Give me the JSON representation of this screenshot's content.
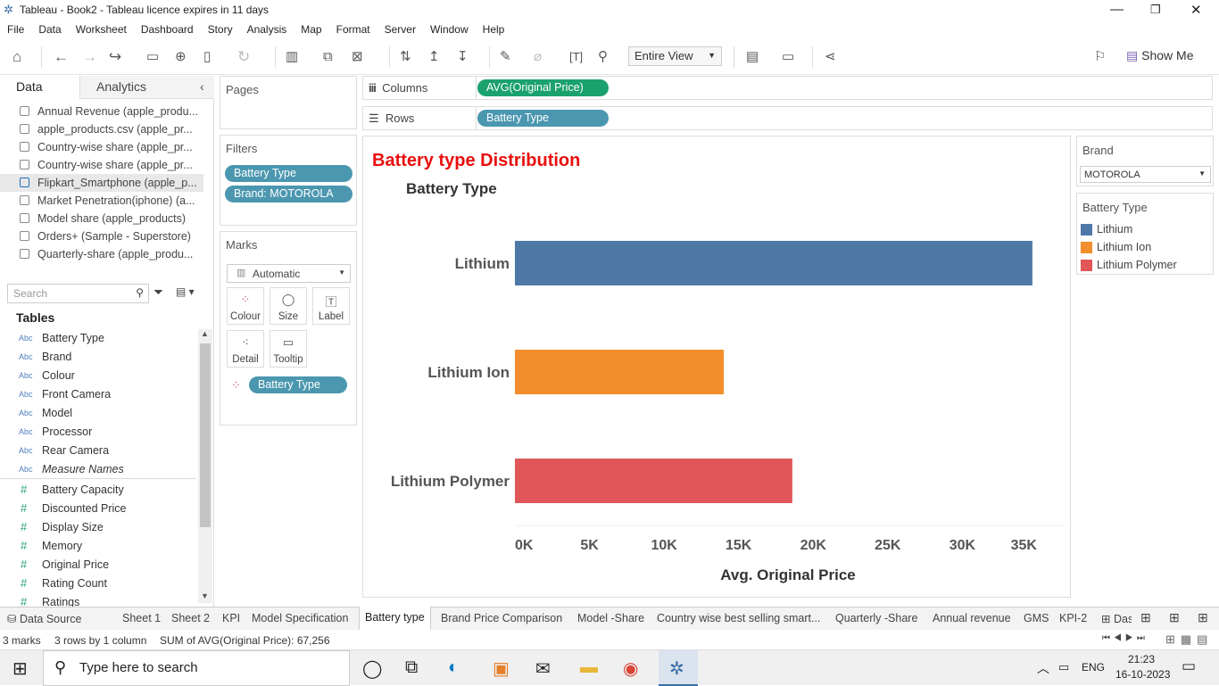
{
  "window": {
    "title": "Tableau - Book2 - Tableau licence expires in 11 days"
  },
  "menu": [
    "File",
    "Data",
    "Worksheet",
    "Dashboard",
    "Story",
    "Analysis",
    "Map",
    "Format",
    "Server",
    "Window",
    "Help"
  ],
  "toolbar": {
    "view_select": "Entire View",
    "show_me": "Show Me"
  },
  "left_pane": {
    "tabs": {
      "data": "Data",
      "analytics": "Analytics"
    },
    "data_sources": [
      "Annual Revenue (apple_produ...",
      "apple_products.csv (apple_pr...",
      "Country-wise share (apple_pr...",
      "Country-wise share (apple_pr...",
      "Flipkart_Smartphone (apple_p...",
      "Market Penetration(iphone) (a...",
      "Model share (apple_products)",
      "Orders+ (Sample - Superstore)",
      "Quarterly-share (apple_produ..."
    ],
    "search_placeholder": "Search",
    "tables_heading": "Tables",
    "dimensions": [
      "Battery Type",
      "Brand",
      "Colour",
      "Front Camera",
      "Model",
      "Processor",
      "Rear Camera",
      "Measure Names"
    ],
    "measures": [
      "Battery Capacity",
      "Discounted Price",
      "Display Size",
      "Memory",
      "Original Price",
      "Rating Count",
      "Ratings"
    ],
    "abc": "Abc",
    "hash": "#"
  },
  "pages": {
    "title": "Pages"
  },
  "filters": {
    "title": "Filters",
    "pills": [
      "Battery Type",
      "Brand: MOTOROLA"
    ]
  },
  "marks": {
    "title": "Marks",
    "type": "Automatic",
    "buttons": [
      "Colour",
      "Size",
      "Label",
      "Detail",
      "Tooltip"
    ],
    "pill": "Battery Type"
  },
  "shelves": {
    "columns_label": "Columns",
    "columns_pill": "AVG(Original Price)",
    "rows_label": "Rows",
    "rows_pill": "Battery Type"
  },
  "chart_data": {
    "type": "bar",
    "orientation": "horizontal",
    "title": "Battery  type Distribution",
    "row_header": "Battery Type",
    "categories": [
      "Lithium",
      "Lithium Ion",
      "Lithium Polymer"
    ],
    "values": [
      34700,
      14000,
      18600
    ],
    "colors": [
      "#4e79a7",
      "#f28e2b",
      "#e15759"
    ],
    "xlabel": "Avg. Original Price",
    "xlim": [
      0,
      36500
    ],
    "xticks": [
      0,
      5000,
      10000,
      15000,
      20000,
      25000,
      30000,
      35000
    ],
    "xtick_labels": [
      "0K",
      "5K",
      "10K",
      "15K",
      "20K",
      "25K",
      "30K",
      "35K"
    ],
    "title_color": "#e8100e"
  },
  "right_pane": {
    "brand_title": "Brand",
    "brand_value": "MOTOROLA",
    "legend_title": "Battery Type",
    "legend": [
      {
        "label": "Lithium",
        "color": "#4e79a7"
      },
      {
        "label": "Lithium Ion",
        "color": "#f28e2b"
      },
      {
        "label": "Lithium Polymer",
        "color": "#e15759"
      }
    ]
  },
  "sheet_tabs": [
    "Data Source",
    "Sheet 1",
    "Sheet 2",
    "KPI",
    "Model Specification",
    "Battery type",
    "Brand Price Comparison",
    "Model -Share",
    "Country wise best selling smart...",
    "Quarterly -Share",
    "Annual revenue",
    "GMS",
    "KPI-2",
    "Das"
  ],
  "active_tab": "Battery type",
  "status": {
    "marks": "3 marks",
    "rows": "3 rows  by  1 column",
    "sum": "SUM of AVG(Original Price): 67,256"
  },
  "taskbar": {
    "search": "Type here to search",
    "lang": "ENG",
    "time": "21:23",
    "date": "16-10-2023"
  }
}
